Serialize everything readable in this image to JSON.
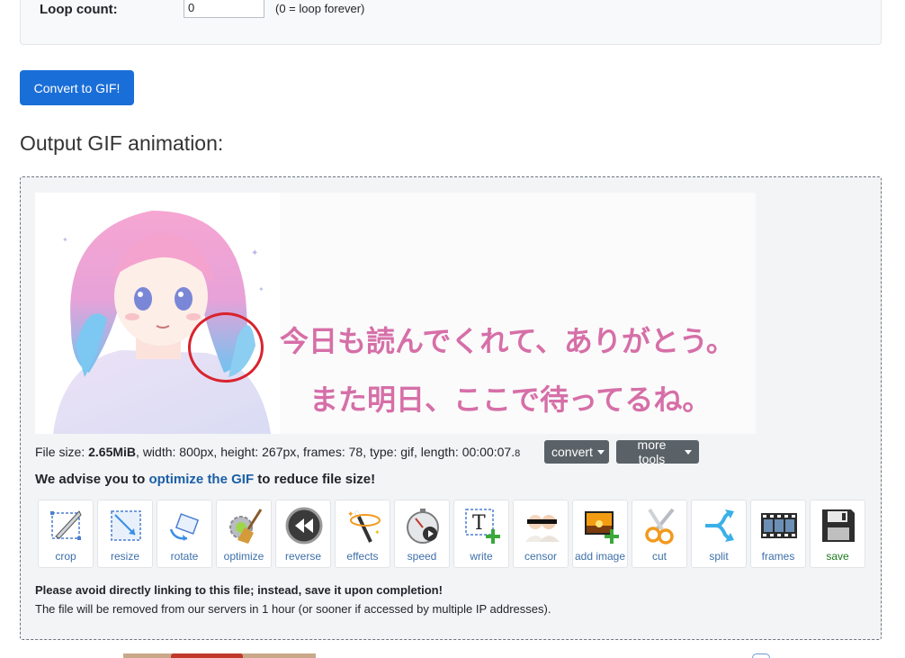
{
  "loop": {
    "label": "Loop count:",
    "value": "0",
    "hint": "(0 = loop forever)"
  },
  "convert_button": "Convert to GIF!",
  "section_title": "Output GIF animation:",
  "gif": {
    "text_line_1": "今日も読んでくれて、ありがとう。",
    "text_line_2": "また明日、ここで待ってるね。"
  },
  "file_info": {
    "prefix": "File size: ",
    "size": "2.65MiB",
    "rest": ", width: 800px, height: 267px, frames: 78, type: gif, length: 00:00:07.",
    "small": "8"
  },
  "dropdowns": {
    "convert": "convert",
    "more_tools": "more tools"
  },
  "advise": {
    "before": "We advise you to ",
    "link": "optimize the GIF",
    "after": " to reduce file size!"
  },
  "tools": [
    {
      "label": "crop",
      "icon": "crop-icon"
    },
    {
      "label": "resize",
      "icon": "resize-icon"
    },
    {
      "label": "rotate",
      "icon": "rotate-icon"
    },
    {
      "label": "optimize",
      "icon": "optimize-broom-icon"
    },
    {
      "label": "reverse",
      "icon": "reverse-icon"
    },
    {
      "label": "effects",
      "icon": "magic-wand-icon"
    },
    {
      "label": "speed",
      "icon": "stopwatch-icon"
    },
    {
      "label": "write",
      "icon": "text-add-icon"
    },
    {
      "label": "censor",
      "icon": "censor-icon"
    },
    {
      "label": "add image",
      "icon": "add-image-icon"
    },
    {
      "label": "cut",
      "icon": "scissors-icon"
    },
    {
      "label": "split",
      "icon": "split-arrow-icon"
    },
    {
      "label": "frames",
      "icon": "film-strip-icon"
    },
    {
      "label": "save",
      "icon": "floppy-disk-icon"
    }
  ],
  "notices": {
    "bold": "Please avoid directly linking to this file; instead, save it upon completion!",
    "normal": "The file will be removed from our servers in 1 hour (or sooner if accessed by multiple IP addresses)."
  },
  "colors": {
    "primary_button": "#1a6ed8",
    "link": "#1b5fa6",
    "highlight_ring": "#d9232d",
    "gif_text": "#d66fa8"
  }
}
